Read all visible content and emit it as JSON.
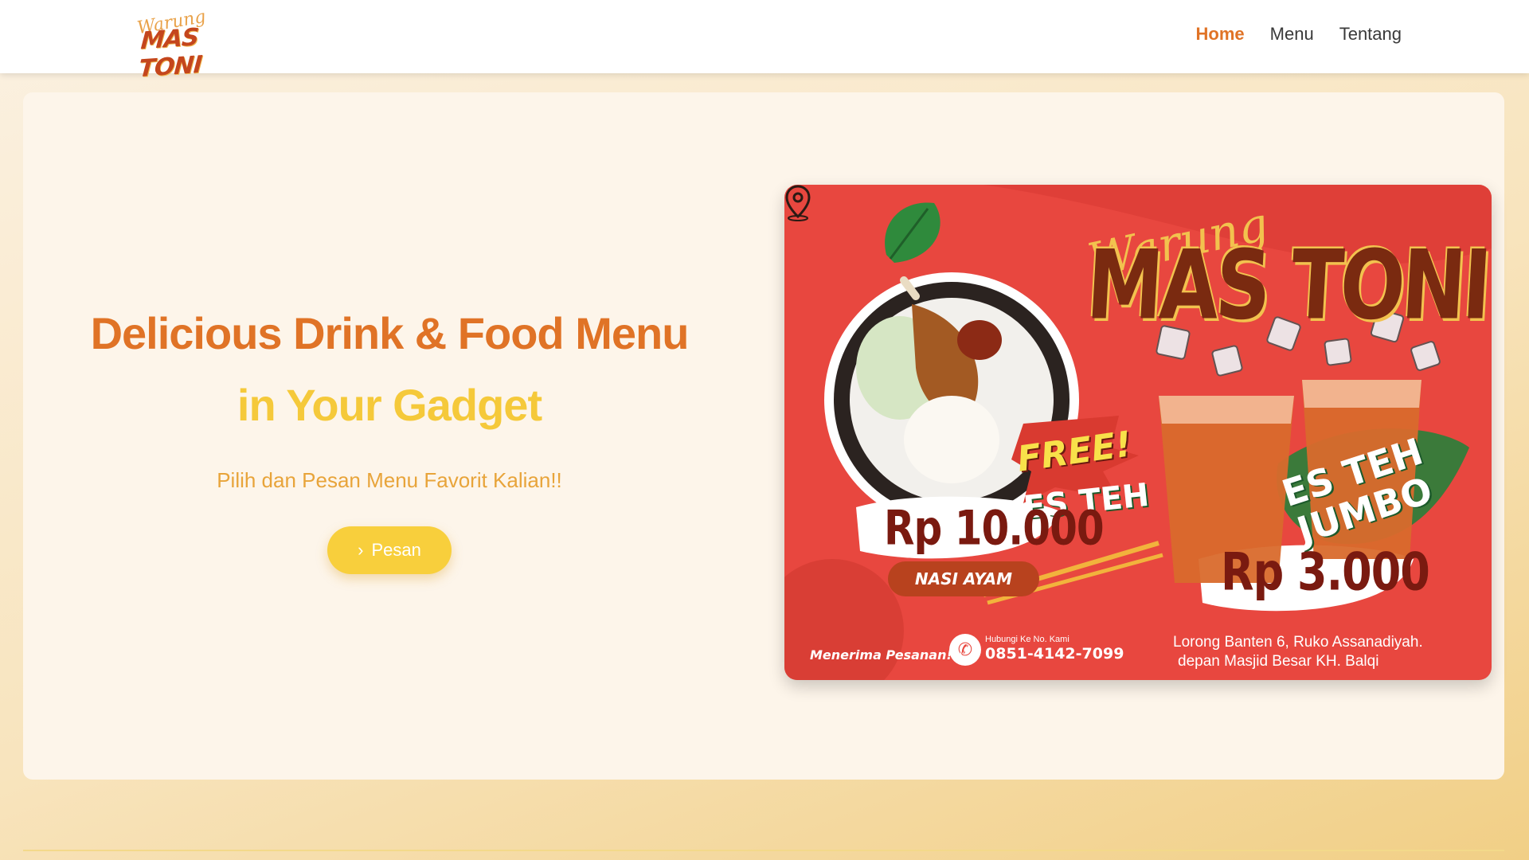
{
  "navbar": {
    "logo_script": "Warung",
    "logo_brand": "MAS TONI",
    "links": [
      {
        "label": "Home",
        "active": true
      },
      {
        "label": "Menu",
        "active": false
      },
      {
        "label": "Tentang",
        "active": false
      }
    ]
  },
  "hero": {
    "headline_line1": "Delicious Drink & Food Menu",
    "headline_line2": "in Your Gadget",
    "subtitle": "Pilih dan Pesan Menu Favorit Kalian!!",
    "order_button": {
      "label": "Pesan",
      "icon": "chevron-right-icon"
    }
  },
  "banner": {
    "script": "Warung",
    "brand": "MAS TONI",
    "free_label": "FREE!",
    "free_item": "ES TEH",
    "nasi_price": "Rp 10.000",
    "nasi_label": "NASI AYAM",
    "jumbo_line1": "ES TEH",
    "jumbo_line2": "JUMBO",
    "teh_price": "Rp 3.000",
    "order_note": "Menerima Pesanan!",
    "phone_caption": "Hubungi Ke No. Kami",
    "phone": "0851-4142-7099",
    "address_line1": "Lorong Banten 6, Ruko Assanadiyah.",
    "address_line2": "depan Masjid Besar KH. Balqi"
  },
  "colors": {
    "accent_orange": "#e07326",
    "accent_yellow": "#f5c93a",
    "banner_red": "#e8473f",
    "button_yellow": "#f8cf3c"
  }
}
